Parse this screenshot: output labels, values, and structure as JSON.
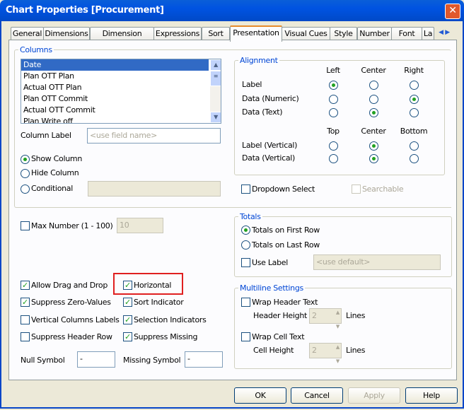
{
  "window": {
    "title": "Chart Properties [Procurement]"
  },
  "tabs": [
    "General",
    "Dimensions",
    "Dimension Limits",
    "Expressions",
    "Sort",
    "Presentation",
    "Visual Cues",
    "Style",
    "Number",
    "Font",
    "La"
  ],
  "active_tab": "Presentation",
  "columns": {
    "title": "Columns",
    "items": [
      "Date",
      "Plan OTT Plan",
      "Actual OTT Plan",
      "Plan OTT Commit",
      "Actual OTT Commit",
      "Plan Write off"
    ],
    "selected": "Date",
    "column_label": "Column Label",
    "column_label_placeholder": "<use field name>",
    "show": "Show Column",
    "hide": "Hide Column",
    "conditional": "Conditional",
    "visibility": "Show Column"
  },
  "alignment": {
    "title": "Alignment",
    "h_headers": [
      "Left",
      "Center",
      "Right"
    ],
    "h_rows": [
      {
        "label": "Label",
        "value": "Left"
      },
      {
        "label": "Data (Numeric)",
        "value": "Right"
      },
      {
        "label": "Data (Text)",
        "value": "Center"
      }
    ],
    "v_headers": [
      "Top",
      "Center",
      "Bottom"
    ],
    "v_rows": [
      {
        "label": "Label (Vertical)",
        "value": "Center"
      },
      {
        "label": "Data (Vertical)",
        "value": "Center"
      }
    ],
    "dropdown_select": "Dropdown Select",
    "searchable": "Searchable"
  },
  "max_number": {
    "label": "Max Number (1 - 100)",
    "value": "10"
  },
  "options": [
    {
      "label": "Allow Drag and Drop",
      "checked": true
    },
    {
      "label": "Horizontal",
      "checked": true
    },
    {
      "label": "Suppress Zero-Values",
      "checked": true
    },
    {
      "label": "Sort Indicator",
      "checked": true
    },
    {
      "label": "Vertical Columns Labels",
      "checked": false
    },
    {
      "label": "Selection Indicators",
      "checked": true
    },
    {
      "label": "Suppress Header Row",
      "checked": false
    },
    {
      "label": "Suppress Missing",
      "checked": true
    }
  ],
  "null_symbol": {
    "label": "Null Symbol",
    "value": "-"
  },
  "missing_symbol": {
    "label": "Missing Symbol",
    "value": "-"
  },
  "totals": {
    "title": "Totals",
    "first": "Totals on First Row",
    "last": "Totals on Last Row",
    "use_label": "Use Label",
    "label_placeholder": "<use default>"
  },
  "multiline": {
    "title": "Multiline Settings",
    "wrap_header": "Wrap Header Text",
    "header_height": "Header Height",
    "header_value": "2",
    "wrap_cell": "Wrap Cell Text",
    "cell_height": "Cell Height",
    "cell_value": "2",
    "lines": "Lines"
  },
  "buttons": {
    "ok": "OK",
    "cancel": "Cancel",
    "apply": "Apply",
    "help": "Help"
  },
  "highlight_color": "#e02020"
}
